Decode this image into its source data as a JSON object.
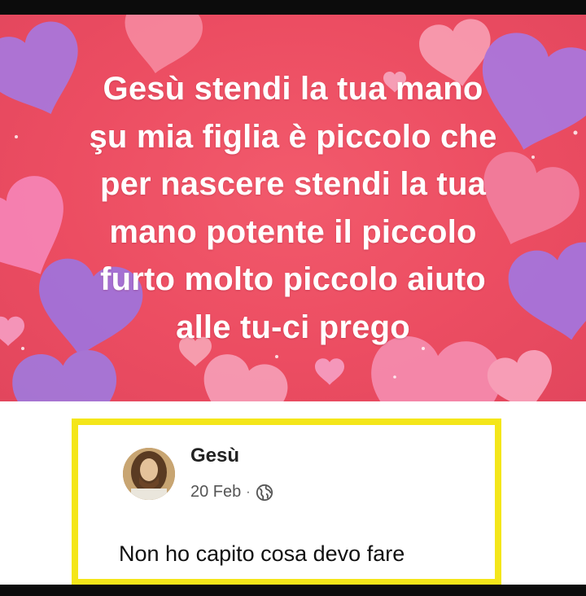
{
  "post": {
    "image_text": "Gesù stendi la tua mano\nşu mia figlia è piccolo che\nper nascere stendi la tua\nmano potente il piccolo\nfurto molto piccolo aiuto\nalle tu-ci prego"
  },
  "comment": {
    "author": "Gesù",
    "date": "20 Feb",
    "separator": "·",
    "privacy_icon": "globe-icon",
    "text": "Non ho capito cosa devo fare"
  },
  "colors": {
    "background_red": "#ec4d62",
    "highlight_border": "#f4e61a",
    "frame": "#0c0c0c"
  }
}
